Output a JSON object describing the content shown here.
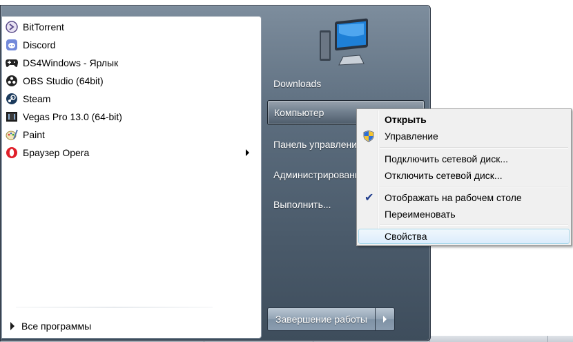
{
  "programs": [
    {
      "label": "BitTorrent",
      "icon": "bittorrent-icon"
    },
    {
      "label": "Discord",
      "icon": "discord-icon"
    },
    {
      "label": "DS4Windows - Ярлык",
      "icon": "gamepad-icon"
    },
    {
      "label": "OBS Studio (64bit)",
      "icon": "obs-icon"
    },
    {
      "label": "Steam",
      "icon": "steam-icon"
    },
    {
      "label": "Vegas Pro 13.0 (64-bit)",
      "icon": "vegas-icon"
    },
    {
      "label": "Paint",
      "icon": "paint-icon"
    },
    {
      "label": "Браузер Opera",
      "icon": "opera-icon",
      "has_submenu": true
    }
  ],
  "all_programs": "Все программы",
  "right_pane": {
    "items": [
      {
        "label": "Downloads"
      },
      {
        "label": "Компьютер"
      },
      {
        "label": "Панель управления"
      },
      {
        "label": "Администрирование"
      },
      {
        "label": "Выполнить..."
      }
    ],
    "shutdown_label": "Завершение работы"
  },
  "context_menu": {
    "items": [
      {
        "label": "Открыть",
        "bold": true
      },
      {
        "label": "Управление",
        "icon": "uac-shield-icon"
      },
      {
        "label": "Подключить сетевой диск..."
      },
      {
        "label": "Отключить сетевой диск..."
      },
      {
        "label": "Отображать на рабочем столе",
        "checked": true
      },
      {
        "label": "Переименовать"
      },
      {
        "label": "Свойства",
        "hovered": true
      }
    ]
  },
  "colors": {
    "menu_bg": "#5b6c7d",
    "ctx_hover_border": "#a8d8eb",
    "check": "#1f3c8c"
  }
}
